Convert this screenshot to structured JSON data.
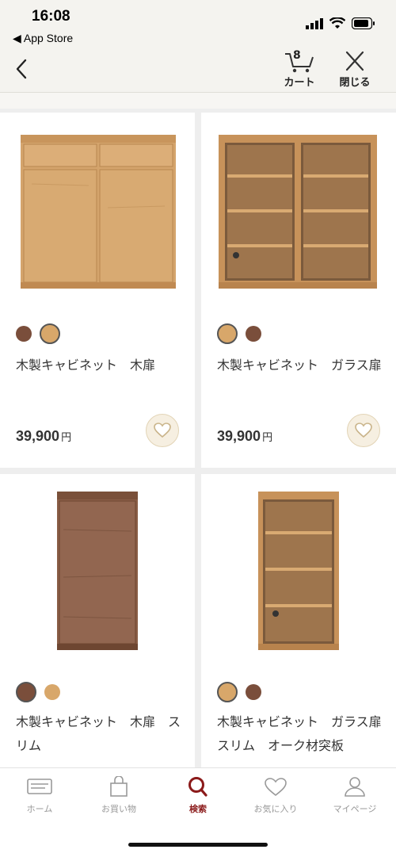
{
  "status": {
    "time": "16:08",
    "back_app": "◀ App Store"
  },
  "nav": {
    "cart_count": "8",
    "cart_label": "カート",
    "close_label": "閉じる"
  },
  "products": [
    {
      "name": "木製キャビネット　木扉",
      "price": "39,900",
      "currency": "円"
    },
    {
      "name": "木製キャビネット　ガラス扉",
      "price": "39,900",
      "currency": "円"
    },
    {
      "name": "木製キャビネット　木扉　スリム",
      "price": "",
      "currency": ""
    },
    {
      "name": "木製キャビネット　ガラス扉　スリム　オーク材突板",
      "price": "",
      "currency": ""
    }
  ],
  "swatch_colors": {
    "walnut": "#7a4e3b",
    "oak": "#d8a76a"
  },
  "tabs": [
    {
      "label": "ホーム",
      "icon": "card-icon"
    },
    {
      "label": "お買い物",
      "icon": "shopping-bag-icon"
    },
    {
      "label": "検索",
      "icon": "search-icon"
    },
    {
      "label": "お気に入り",
      "icon": "heart-icon"
    },
    {
      "label": "マイページ",
      "icon": "person-icon"
    }
  ],
  "active_tab": "検索"
}
